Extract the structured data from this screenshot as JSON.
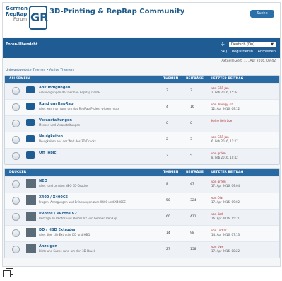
{
  "header": {
    "logo_line1": "German",
    "logo_line2": "RepRap",
    "logo_line3": "Forum",
    "logo_mark": "GR",
    "title": "3D-Printing & RepRap Community",
    "search_label": "Suche"
  },
  "navbar": {
    "board_index": "Foren-Übersicht",
    "language": "Deutsch (Du)",
    "links": [
      "FAQ",
      "Registrieren",
      "Anmelden"
    ]
  },
  "date_line": "Aktuelle Zeit: 17. Apr 2016, 09:42",
  "breadcrumb": "Unbeantwortete Themen • Aktive Themen",
  "sections": [
    {
      "head": {
        "forum": "ALLGEMEIN",
        "topics": "THEMEN",
        "posts": "BEITRÄGE",
        "last": "LETZTER BEITRAG"
      },
      "rows": [
        {
          "name": "Ankündigungen",
          "desc": "Ankündigungen der German RepRap GmbH",
          "topics": "3",
          "posts": "3",
          "last_by": "von GRR Jan",
          "last_date": "2. Feb 2016, 15:44"
        },
        {
          "name": "Rund um RepRap",
          "desc": "Alles was man rund um das RepRap-Projekt wissen muss",
          "topics": "4",
          "posts": "16",
          "last_by": "von Prodigy 3D",
          "last_date": "12. Apr 2016, 09:12"
        },
        {
          "name": "Veranstaltungen",
          "desc": "Messen und Veranstaltungen",
          "topics": "0",
          "posts": "0",
          "last_by": "Keine Beiträge",
          "last_date": ""
        },
        {
          "name": "Neuigkeiten",
          "desc": "Neuigkeiten aus der Welt des 3D-Drucks",
          "topics": "2",
          "posts": "3",
          "last_by": "von GRR Jan",
          "last_date": "6. Feb 2016, 11:27"
        },
        {
          "name": "Off Topic",
          "desc": "",
          "topics": "2",
          "posts": "5",
          "last_by": "von grrkm",
          "last_date": "8. Feb 2016, 10:42"
        }
      ]
    },
    {
      "head": {
        "forum": "DRUCKER",
        "topics": "THEMEN",
        "posts": "BEITRÄGE",
        "last": "LETZTER BEITRAG"
      },
      "rows": [
        {
          "name": "NEO",
          "desc": "Alles rund um den NEO 3D-Drucker",
          "topics": "8",
          "posts": "47",
          "last_by": "von grrkm",
          "last_date": "17. Apr 2016, 09:04"
        },
        {
          "name": "X400 / X400CE",
          "desc": "Fragen, Anregungen und Erfahrungen zum X400 und X400CE",
          "topics": "50",
          "posts": "324",
          "last_by": "von Olaf",
          "last_date": "17. Apr 2016, 09:02"
        },
        {
          "name": "PRotos / PRotos V2",
          "desc": "Beiträge zu PRotos und PRotos V2 von German RepRap",
          "topics": "60",
          "posts": "411",
          "last_by": "von Karl",
          "last_date": "16. Apr 2016, 15:21"
        },
        {
          "name": "DD / HBD Extruder",
          "desc": "Alles über die Extruder DD und HBD",
          "topics": "14",
          "posts": "98",
          "last_by": "von Lothar",
          "last_date": "14. Apr 2016, 07:13"
        },
        {
          "name": "Anzeigen",
          "desc": "Biete und Suche rund um den 3D-Druck",
          "topics": "27",
          "posts": "158",
          "last_by": "von Uwe",
          "last_date": "17. Apr 2016, 08:22"
        }
      ]
    }
  ]
}
